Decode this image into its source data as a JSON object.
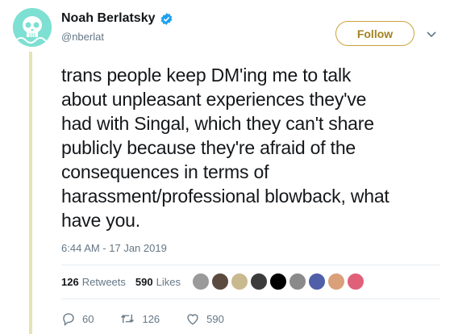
{
  "user": {
    "name": "Noah Berlatsky",
    "handle": "@nberlat"
  },
  "follow_label": "Follow",
  "tweet": {
    "text_lines": [
      "trans people keep DM'ing me to talk",
      "about unpleasant experiences they've",
      "had with Singal, which they can't share",
      "publicly because they're afraid of the",
      "consequences in terms of",
      "harassment/professional blowback, what",
      "have you."
    ],
    "timestamp": "6:44 AM - 17 Jan 2019"
  },
  "stats": {
    "retweets": "126",
    "retweets_label": "Retweets",
    "likes": "590",
    "likes_label": "Likes"
  },
  "likers": [
    {
      "color": "#9a9a9a"
    },
    {
      "color": "#5b4a3f"
    },
    {
      "color": "#c9b98f"
    },
    {
      "color": "#3c3c3c"
    },
    {
      "color": "#000000"
    },
    {
      "color": "#8a8a8a"
    },
    {
      "color": "#4f5fa8"
    },
    {
      "color": "#d9a079"
    },
    {
      "color": "#e0607a"
    }
  ],
  "actions": {
    "replies": "60",
    "retweets": "126",
    "likes": "590"
  },
  "colors": {
    "follow_border": "#c9a33a",
    "follow_text": "#a3831e",
    "thread_line": "#e8e3b4",
    "verified": "#1da1f2",
    "avatar_bg": "#7ee0d2"
  }
}
